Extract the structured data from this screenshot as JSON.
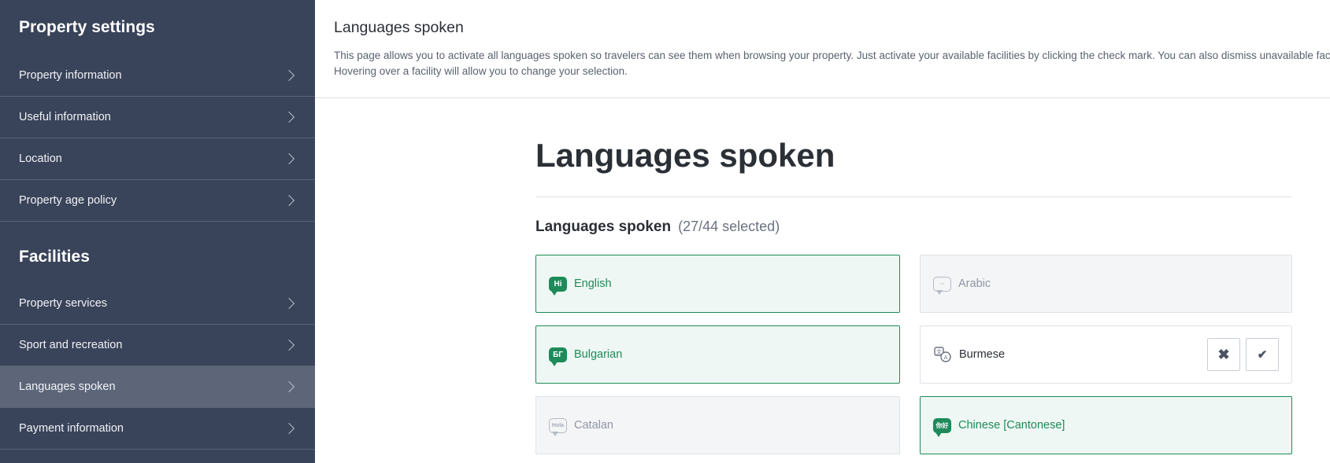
{
  "sidebar": {
    "property_settings_title": "Property settings",
    "property_settings_items": [
      {
        "label": "Property information"
      },
      {
        "label": "Useful information"
      },
      {
        "label": "Location"
      },
      {
        "label": "Property age policy"
      }
    ],
    "facilities_title": "Facilities",
    "facilities_items": [
      {
        "label": "Property services"
      },
      {
        "label": "Sport and recreation"
      },
      {
        "label": "Languages spoken",
        "active": true
      },
      {
        "label": "Payment information"
      }
    ]
  },
  "header": {
    "title": "Languages spoken",
    "description_line1": "This page allows you to activate all languages spoken so travelers can see them when browsing your property. Just activate your available facilities by clicking the check mark. You can also dismiss unavailable facilities",
    "description_line2": "Hovering over a facility will allow you to change your selection."
  },
  "main": {
    "page_title": "Languages spoken",
    "section_title": "Languages spoken",
    "selected_count": "(27/44 selected)",
    "languages": [
      {
        "label": "English",
        "state": "on",
        "icon": "Hi",
        "icon_name": "english-speech-icon"
      },
      {
        "label": "Arabic",
        "state": "off",
        "icon": "ىمرحبا",
        "icon_name": "arabic-speech-icon"
      },
      {
        "label": "Bulgarian",
        "state": "on",
        "icon": "БГ",
        "icon_name": "bulgarian-speech-icon"
      },
      {
        "label": "Burmese",
        "state": "pending",
        "icon": "文A",
        "icon_name": "translate-icon"
      },
      {
        "label": "Catalan",
        "state": "off",
        "icon": "Hola",
        "icon_name": "catalan-speech-icon"
      },
      {
        "label": "Chinese [Cantonese]",
        "state": "on",
        "icon": "你好",
        "icon_name": "cantonese-speech-icon"
      }
    ],
    "dismiss_symbol": "✖",
    "confirm_symbol": "✔"
  },
  "colors": {
    "sidebar_bg": "#394359",
    "sidebar_active": "#5d6679",
    "accent_green": "#1e8a5a"
  }
}
